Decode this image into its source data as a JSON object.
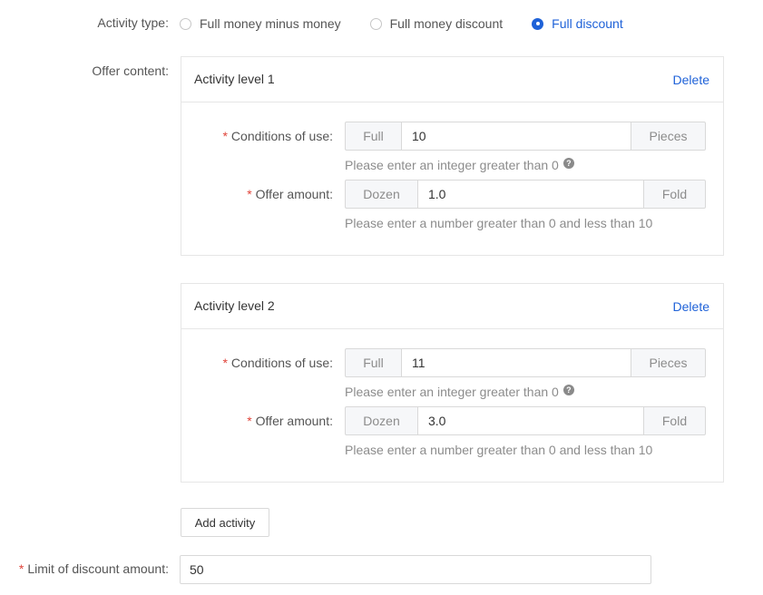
{
  "activity_type": {
    "label": "Activity type:",
    "options": [
      {
        "label": "Full money minus money",
        "checked": false
      },
      {
        "label": "Full money discount",
        "checked": false
      },
      {
        "label": "Full discount",
        "checked": true
      }
    ]
  },
  "offer_content": {
    "label": "Offer content:",
    "levels": [
      {
        "title": "Activity level 1",
        "delete_label": "Delete",
        "conditions_label": "Conditions of use:",
        "conditions_prefix": "Full",
        "conditions_value": "10",
        "conditions_suffix": "Pieces",
        "conditions_hint": "Please enter an integer greater than 0",
        "offer_label": "Offer amount:",
        "offer_prefix": "Dozen",
        "offer_value": "1.0",
        "offer_suffix": "Fold",
        "offer_hint": "Please enter a number greater than 0 and less than 10"
      },
      {
        "title": "Activity level 2",
        "delete_label": "Delete",
        "conditions_label": "Conditions of use:",
        "conditions_prefix": "Full",
        "conditions_value": "11",
        "conditions_suffix": "Pieces",
        "conditions_hint": "Please enter an integer greater than 0",
        "offer_label": "Offer amount:",
        "offer_prefix": "Dozen",
        "offer_value": "3.0",
        "offer_suffix": "Fold",
        "offer_hint": "Please enter a number greater than 0 and less than 10"
      }
    ]
  },
  "add_activity_label": "Add activity",
  "limit": {
    "label": "Limit of discount amount:",
    "value": "50"
  },
  "required_mark": "*",
  "help_icon_glyph": "?",
  "colors": {
    "accent": "#1f62d8",
    "required": "#e0443a"
  }
}
